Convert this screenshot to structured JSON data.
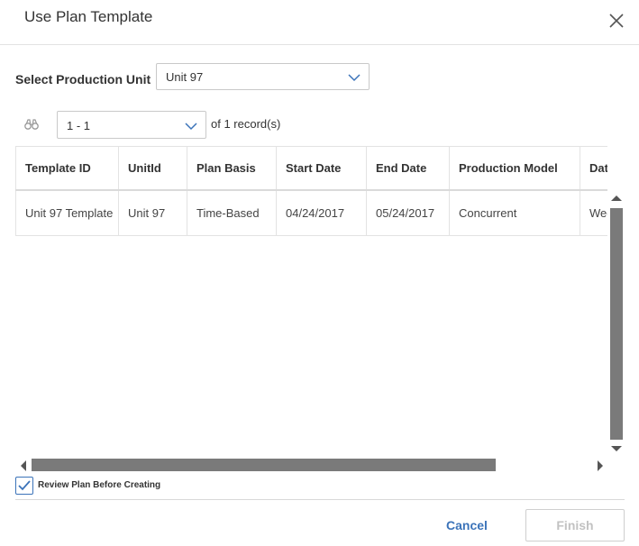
{
  "dialog": {
    "title": "Use Plan Template"
  },
  "production_unit": {
    "label": "Select Production Unit",
    "selected": "Unit 97"
  },
  "pager": {
    "range": "1 - 1",
    "summary": "of 1 record(s)"
  },
  "grid": {
    "columns": [
      "Template ID",
      "UnitId",
      "Plan Basis",
      "Start Date",
      "End Date",
      "Production Model",
      "Dat"
    ],
    "rows": [
      [
        "Unit 97 Template",
        "Unit 97",
        "Time-Based",
        "04/24/2017",
        "05/24/2017",
        "Concurrent",
        "Wee"
      ]
    ]
  },
  "review": {
    "label": "Review Plan Before Creating",
    "checked": true
  },
  "actions": {
    "cancel": "Cancel",
    "finish": "Finish"
  },
  "colors": {
    "accent": "#3b73b9",
    "scrollbar": "#7a7a7a",
    "disabled": "#c2c2c2"
  },
  "icons": [
    "close-icon",
    "binoculars-icon",
    "chevron-down-icon",
    "checkmark-icon"
  ]
}
